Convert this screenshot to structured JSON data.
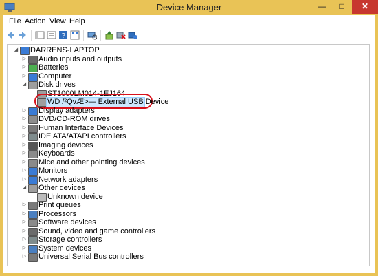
{
  "window": {
    "title": "Device Manager"
  },
  "menu": [
    "File",
    "Action",
    "View",
    "Help"
  ],
  "tree": {
    "root": "DARRENS-LAPTOP",
    "categories": [
      {
        "label": "Audio inputs and outputs",
        "icon": "speaker-icon"
      },
      {
        "label": "Batteries",
        "icon": "battery-icon"
      },
      {
        "label": "Computer",
        "icon": "computer-icon"
      },
      {
        "label": "Disk drives",
        "icon": "disk-icon",
        "expanded": true,
        "children": [
          {
            "label": "ST1000LM014-1EJ164",
            "icon": "disk-icon"
          },
          {
            "label": "WD /²QvÆ>— External USB Device",
            "icon": "disk-icon",
            "selected": true
          }
        ]
      },
      {
        "label": "Display adapters",
        "icon": "monitor-icon"
      },
      {
        "label": "DVD/CD-ROM drives",
        "icon": "dvd-icon"
      },
      {
        "label": "Human Interface Devices",
        "icon": "hid-icon"
      },
      {
        "label": "IDE ATA/ATAPI controllers",
        "icon": "controller-icon"
      },
      {
        "label": "Imaging devices",
        "icon": "camera-icon"
      },
      {
        "label": "Keyboards",
        "icon": "keyboard-icon"
      },
      {
        "label": "Mice and other pointing devices",
        "icon": "mouse-icon"
      },
      {
        "label": "Monitors",
        "icon": "monitor-icon"
      },
      {
        "label": "Network adapters",
        "icon": "network-icon"
      },
      {
        "label": "Other devices",
        "icon": "unknown-icon",
        "expanded": true,
        "children": [
          {
            "label": "Unknown device",
            "icon": "warning-icon"
          }
        ]
      },
      {
        "label": "Print queues",
        "icon": "printer-icon"
      },
      {
        "label": "Processors",
        "icon": "cpu-icon"
      },
      {
        "label": "Software devices",
        "icon": "software-icon"
      },
      {
        "label": "Sound, video and game controllers",
        "icon": "speaker-icon"
      },
      {
        "label": "Storage controllers",
        "icon": "controller-icon"
      },
      {
        "label": "System devices",
        "icon": "system-icon"
      },
      {
        "label": "Universal Serial Bus controllers",
        "icon": "usb-icon"
      }
    ]
  },
  "colors": {
    "titlebar": "#e9c356",
    "close": "#c7372f",
    "selection": "#cde8ff",
    "annotation": "#d8111b"
  }
}
